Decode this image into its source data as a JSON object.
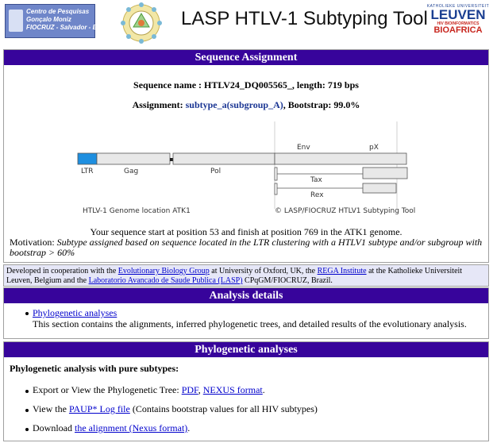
{
  "header": {
    "lasp_logo_lines": [
      "Centro de Pesquisas",
      "Gonçalo Moniz",
      "FIOCRUZ - Salvador - Ba"
    ],
    "title": "LASP HTLV-1 Subtyping Tool",
    "leuven_top": "KATHOLIEKE UNIVERSITEIT",
    "leuven_name": "LEUVEN",
    "leuven_sub": "HIV BIOINFORMATICS",
    "leuven_bio": "BIOAFRICA"
  },
  "assignment": {
    "heading": "Sequence Assignment",
    "seq_label": "Sequence name : HTLV24_DQ005565_, length: 719 bps",
    "assign_prefix": "Assignment: ",
    "assign_value": "subtype_a(subgroup_A)",
    "assign_suffix": ", Bootstrap: 99.0%",
    "genome": {
      "labels": {
        "ltr": "LTR",
        "gag": "Gag",
        "pol": "Pol",
        "env": "Env",
        "px": "pX",
        "tax": "Tax",
        "rex": "Rex"
      },
      "location_label": "HTLV-1 Genome location ATK1",
      "copyright": "© LASP/FIOCRUZ HTLV1 Subtyping Tool",
      "highlight_color": "#1e8fe0"
    },
    "position_text": "Your sequence start at position 53 and finish at position 769 in the ATK1 genome.",
    "motivation_label": "Motivation: ",
    "motivation_text": "Subtype assigned based on sequence located in the LTR clustering with a HTLV1 subtype and/or subgroup with bootstrap > 60%"
  },
  "coop": {
    "t1": "Developed in cooperation with the ",
    "l1": "Evolutionary Biology Group",
    "t2": " at University of Oxford, UK, the ",
    "l2": "REGA Institute",
    "t3": " at the Katholieke Universiteit Leuven, Belgium and the ",
    "l3": "Laboratorio Avancado de Saude Publica (LASP)",
    "t4": " CPqGM/FIOCRUZ, Brazil."
  },
  "analysis": {
    "heading": "Analysis details",
    "link": "Phylogenetic analyses",
    "desc": "This section contains the alignments, inferred phylogenetic trees, and detailed results of the evolutionary analysis."
  },
  "phylo": {
    "heading": "Phylogenetic analyses",
    "subheading": "Phylogenetic analysis with pure subtypes:",
    "i1_text": "Export or View the Phylogenetic Tree: ",
    "i1_l1": "PDF",
    "i1_sep": ", ",
    "i1_l2": "NEXUS format",
    "i1_end": ".",
    "i2_text": "View the ",
    "i2_link": "PAUP* Log file",
    "i2_end": " (Contains bootstrap values for all HIV subtypes)",
    "i3_text": "Download ",
    "i3_link": "the alignment (Nexus format)",
    "i3_end": "."
  }
}
